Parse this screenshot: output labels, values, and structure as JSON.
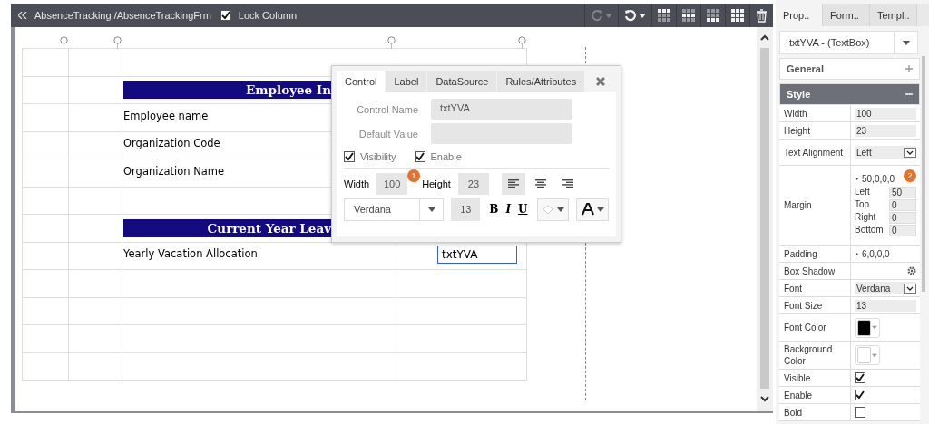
{
  "toolbar": {
    "breadcrumb": "AbsenceTracking /AbsenceTrackingFrm",
    "lock_column": {
      "label": "Lock Column",
      "checked": true
    },
    "tools": [
      {
        "kind": "redo",
        "disabled": true
      },
      {
        "kind": "undo",
        "disabled": false
      },
      {
        "kind": "grid-top"
      },
      {
        "kind": "grid-middle"
      },
      {
        "kind": "grid-bottom"
      },
      {
        "kind": "grid-full"
      },
      {
        "kind": "delete"
      }
    ]
  },
  "canvas": {
    "rows": [
      {
        "kind": "empty"
      },
      {
        "kind": "banner",
        "text": "Employee In"
      },
      {
        "kind": "label",
        "text": "Employee name"
      },
      {
        "kind": "label",
        "text": "Organization Code"
      },
      {
        "kind": "label",
        "text": "Organization Name"
      },
      {
        "kind": "empty"
      },
      {
        "kind": "banner",
        "text": "Current Year Leav"
      },
      {
        "kind": "field",
        "text": "Yearly Vacation Allocation",
        "value": "txtYVA",
        "selected": true
      },
      {
        "kind": "empty"
      },
      {
        "kind": "empty"
      },
      {
        "kind": "empty"
      },
      {
        "kind": "empty"
      }
    ]
  },
  "popup": {
    "tabs": [
      {
        "label": "Control",
        "selected": true
      },
      {
        "label": "Label",
        "selected": false
      },
      {
        "label": "DataSource",
        "selected": false
      },
      {
        "label": "Rules/Attributes",
        "selected": false
      }
    ],
    "fields": [
      {
        "label": "Control Name",
        "value": "txtYVA"
      },
      {
        "label": "Default Value"
      }
    ],
    "checks": [
      {
        "label": "Visibility",
        "checked": true
      },
      {
        "label": "Enable",
        "checked": true
      }
    ],
    "width": {
      "label": "Width",
      "value": "100",
      "badge": "1"
    },
    "height": {
      "label": "Height",
      "value": "23"
    },
    "align": [
      {
        "kind": "left",
        "selected": true
      },
      {
        "kind": "center",
        "selected": false
      },
      {
        "kind": "right",
        "selected": false
      }
    ],
    "font": "Verdana",
    "font_size": "13",
    "format": [
      "B",
      "I",
      "U"
    ]
  },
  "panel": {
    "tabs": [
      {
        "label": "Prop..",
        "selected": true
      },
      {
        "label": "Form..",
        "selected": false
      },
      {
        "label": "Templ..",
        "selected": false
      }
    ],
    "selector": "txtYVA - (TextBox)",
    "sections": [
      {
        "title": "General",
        "expanded": false
      },
      {
        "title": "Style",
        "expanded": true
      }
    ],
    "properties": [
      {
        "kind": "input",
        "label": "Width",
        "value": "100"
      },
      {
        "kind": "input",
        "label": "Height",
        "value": "23"
      },
      {
        "kind": "select",
        "label": "Text Alignment",
        "value": "Left"
      },
      {
        "kind": "margin",
        "label": "Margin",
        "value": "50,0,0,0",
        "expanded": true,
        "badge": "2",
        "parts": [
          {
            "label": "Left",
            "value": "50"
          },
          {
            "label": "Top",
            "value": "0"
          },
          {
            "label": "Right",
            "value": "0"
          },
          {
            "label": "Bottom",
            "value": "0"
          }
        ]
      },
      {
        "kind": "collapsed",
        "label": "Padding",
        "value": "6,0,0,0",
        "expanded": false
      },
      {
        "kind": "gear",
        "label": "Box Shadow"
      },
      {
        "kind": "select",
        "label": "Font",
        "value": "Verdana"
      },
      {
        "kind": "input",
        "label": "Font Size",
        "value": "13"
      },
      {
        "kind": "color",
        "label": "Font Color",
        "color": "#000000"
      },
      {
        "kind": "color",
        "label": "Background Color",
        "color": "#ffffff"
      },
      {
        "kind": "check",
        "label": "Visible",
        "checked": true
      },
      {
        "kind": "check",
        "label": "Enable",
        "checked": true
      },
      {
        "kind": "check",
        "label": "Bold",
        "checked": false
      }
    ]
  }
}
